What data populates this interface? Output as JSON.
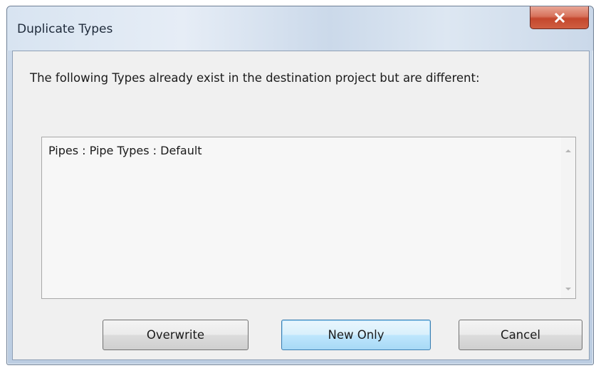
{
  "window": {
    "title": "Duplicate Types",
    "close_icon": "close-x-icon"
  },
  "message": "The following Types already exist in the destination project but are different:",
  "list": {
    "items": [
      "Pipes : Pipe Types : Default"
    ],
    "scroll_up_icon": "scroll-up-arrow-icon",
    "scroll_down_icon": "scroll-down-arrow-icon"
  },
  "buttons": {
    "overwrite": "Overwrite",
    "new_only": "New Only",
    "cancel": "Cancel",
    "default": "new_only"
  },
  "colors": {
    "close_button": "#c4472d",
    "default_button_border": "#3c7fb1"
  }
}
